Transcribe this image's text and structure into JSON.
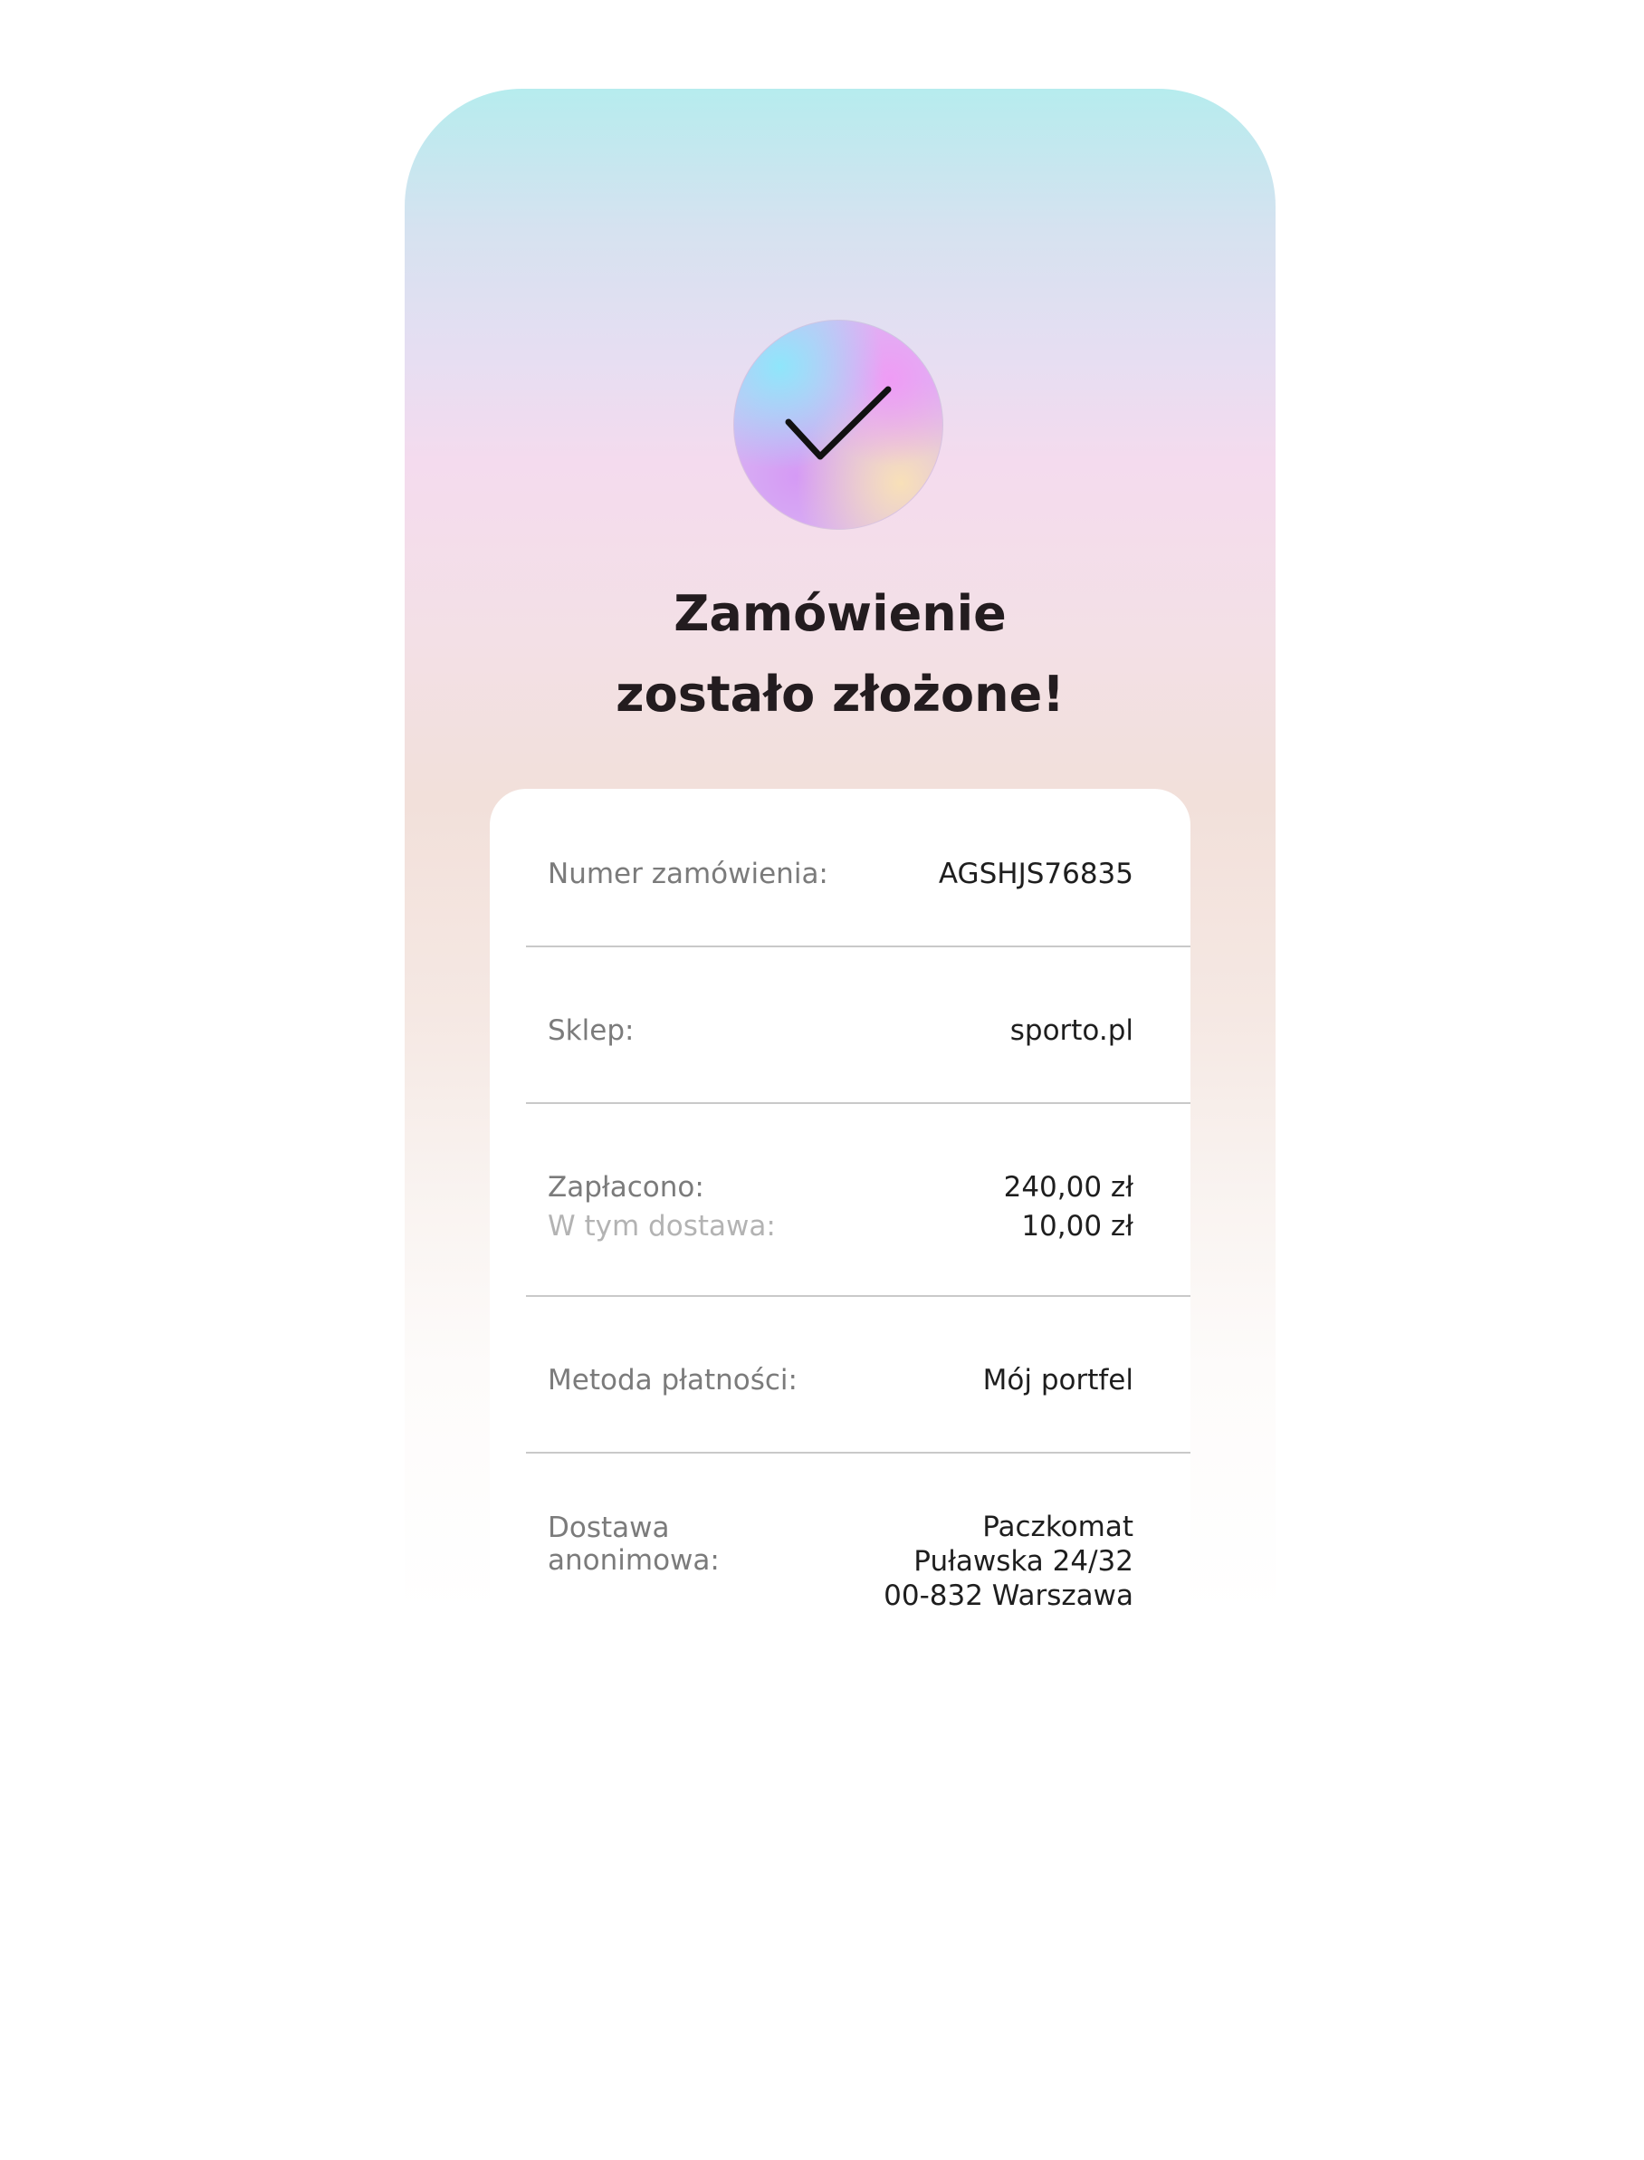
{
  "confirmation": {
    "title_line1": "Zamówienie",
    "title_line2": "zostało złożone!"
  },
  "order_details": {
    "order_number": {
      "label": "Numer zamówienia:",
      "value": "AGSHJS76835"
    },
    "shop": {
      "label": "Sklep:",
      "value": "sporto.pl"
    },
    "paid": {
      "label": "Zapłacono:",
      "value": "240,00 zł"
    },
    "shipping_included": {
      "label": "W tym dostawa:",
      "value": "10,00 zł"
    },
    "payment_method": {
      "label": "Metoda płatności:",
      "value": "Mój portfel"
    },
    "delivery": {
      "label_line1": "Dostawa",
      "label_line2": "anonimowa:",
      "value_line1": "Paczkomat",
      "value_line2": "Puławska 24/32",
      "value_line3": "00-832 Warszawa"
    }
  },
  "colors": {
    "gradient_top": "#b6ecee",
    "gradient_mid": "#f4dbee",
    "gradient_warm": "#f2e0da",
    "title_text": "#231c1f",
    "label_text": "#7b7b7b",
    "value_text": "#1e1e1e",
    "divider": "#c9c9c9"
  },
  "icons": {
    "status_icon": "checkmark-icon"
  }
}
